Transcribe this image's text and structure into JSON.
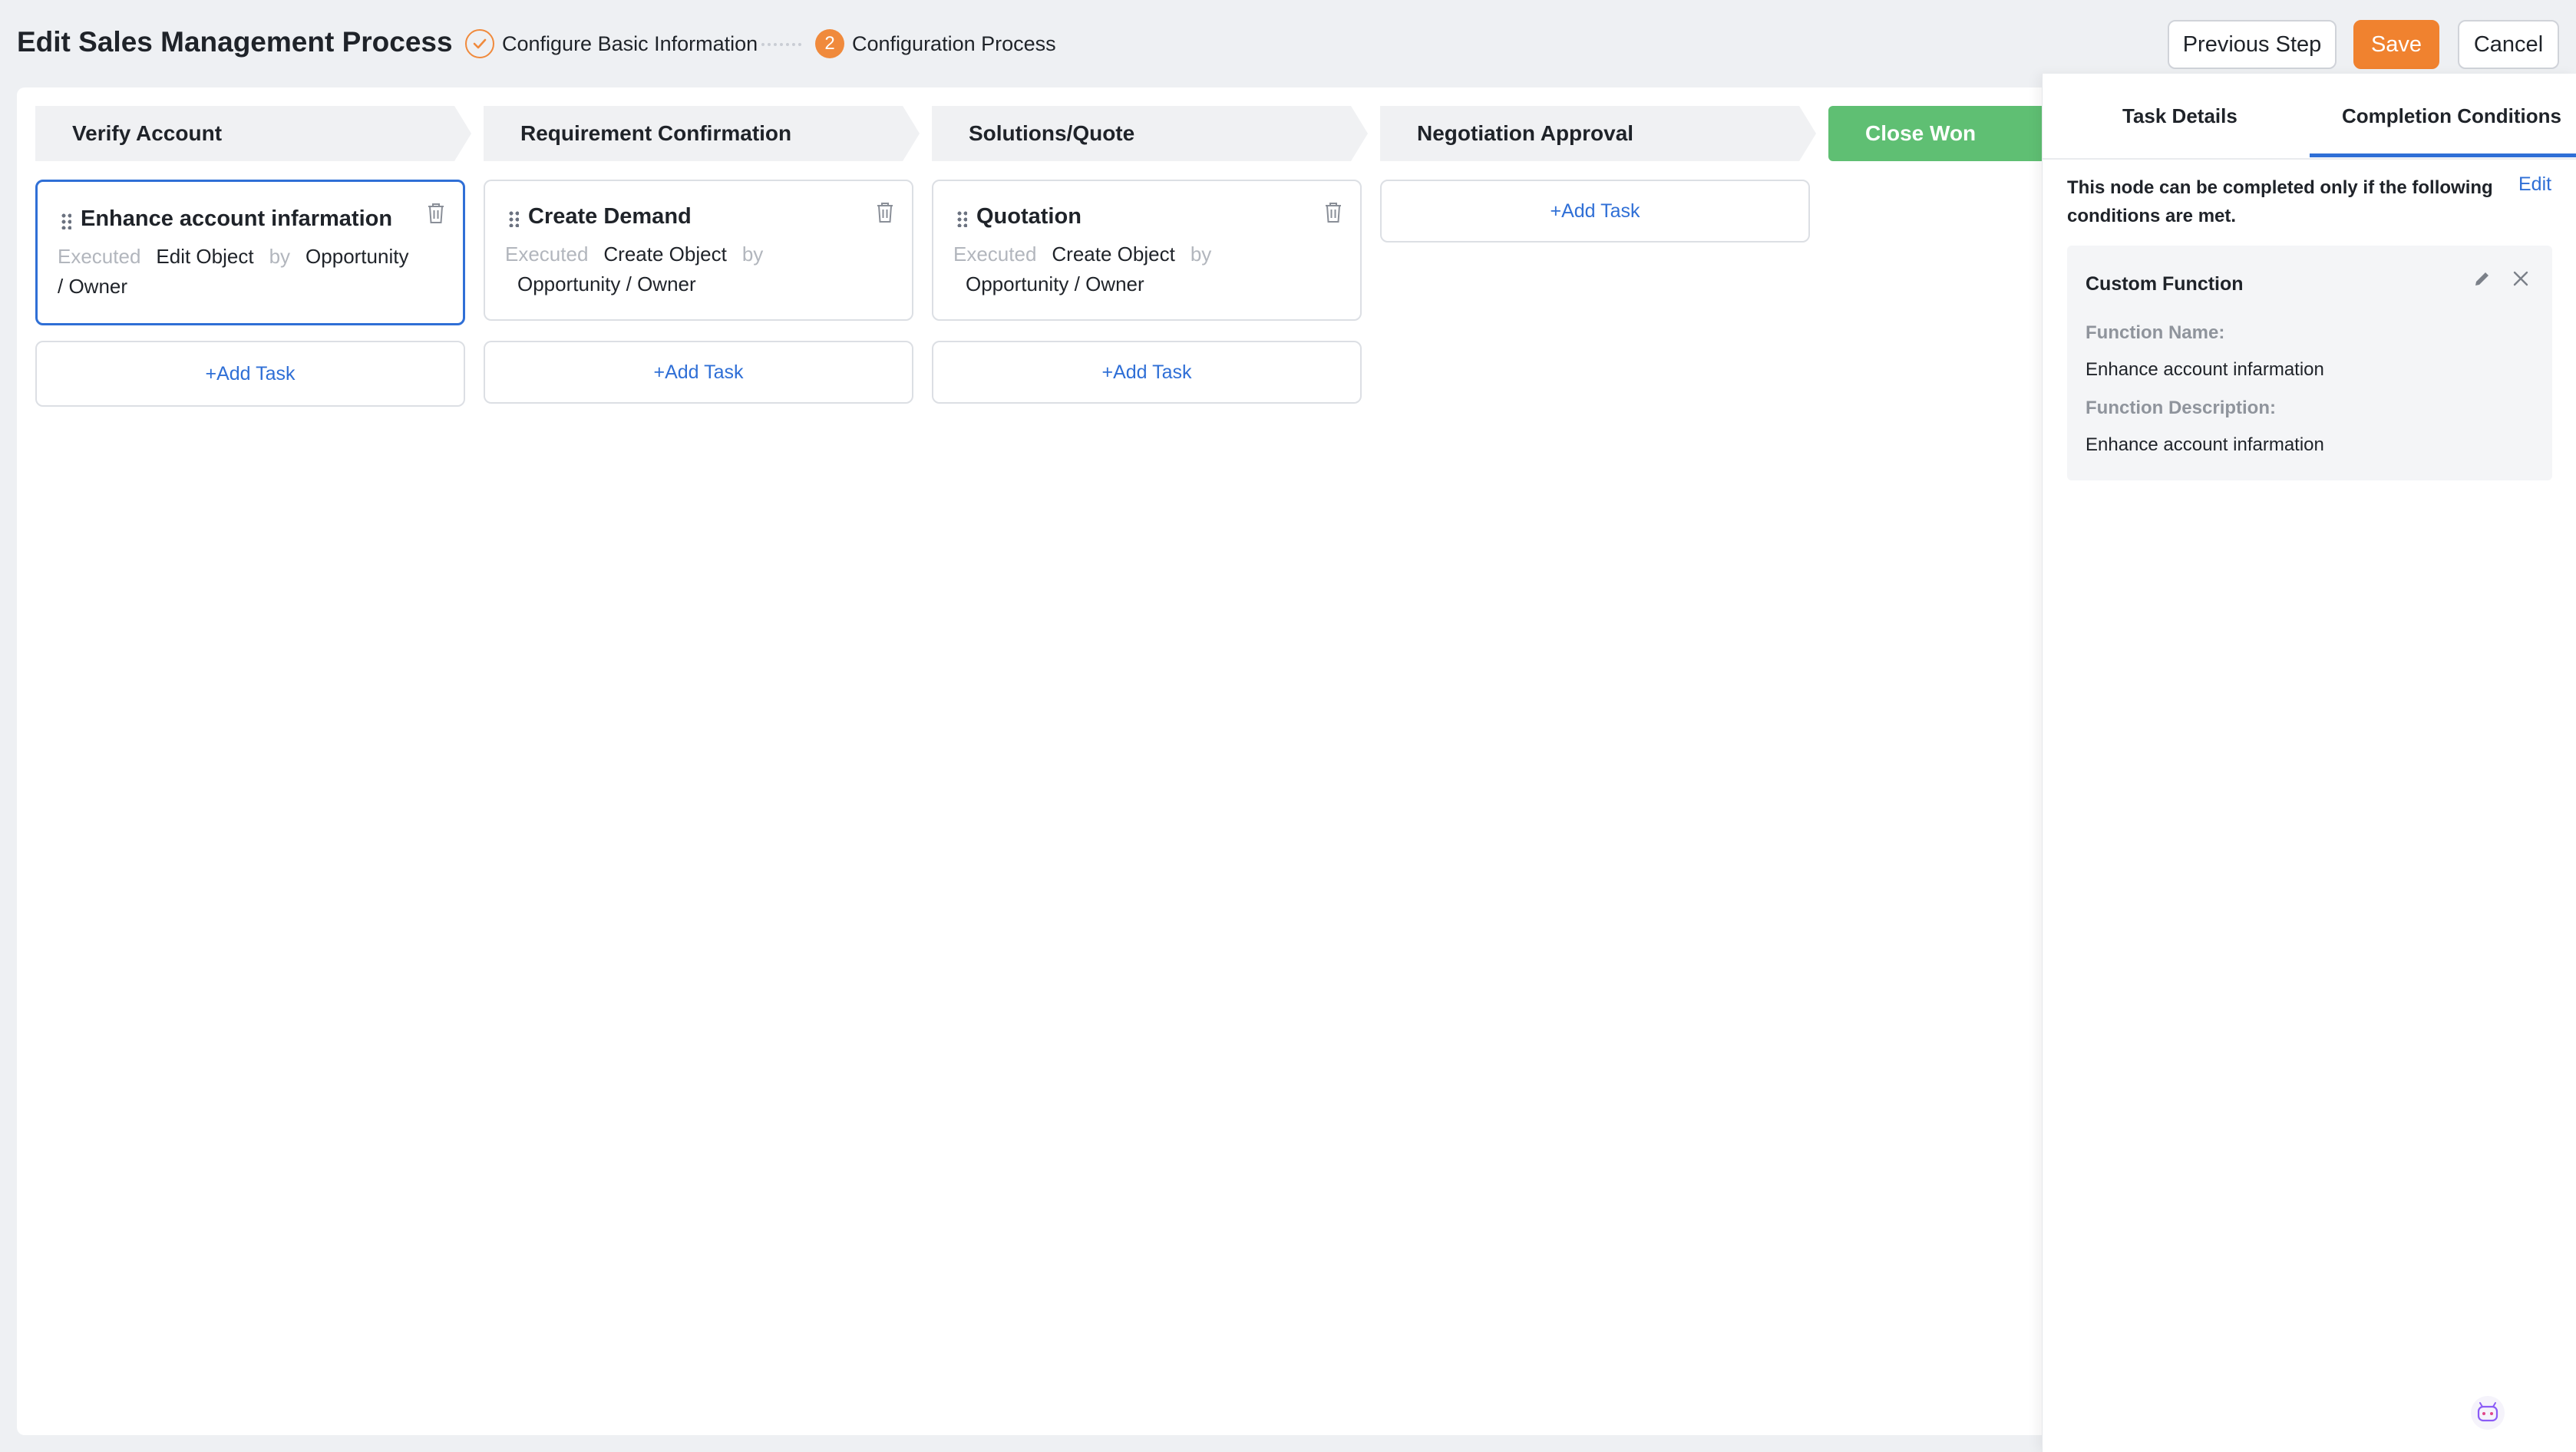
{
  "header": {
    "title": "Edit Sales Management Process",
    "steps": [
      {
        "label": "Configure Basic Information",
        "status": "done"
      },
      {
        "number": "2",
        "label": "Configuration Process",
        "status": "active"
      }
    ],
    "buttons": {
      "previous": "Previous Step",
      "save": "Save",
      "cancel": "Cancel"
    }
  },
  "stages": [
    {
      "name": "Verify Account"
    },
    {
      "name": "Requirement Confirmation"
    },
    {
      "name": "Solutions/Quote"
    },
    {
      "name": "Negotiation Approval"
    },
    {
      "name": "Close Won"
    }
  ],
  "tasks": [
    {
      "title": "Enhance account infarmation",
      "executed": "Executed",
      "action": "Edit Object",
      "by": "by",
      "object": "Opportunity",
      "role": "/ Owner"
    },
    {
      "title": "Create Demand",
      "executed": "Executed",
      "action": "Create Object",
      "by": "by",
      "object": "Opportunity / Owner"
    },
    {
      "title": "Quotation",
      "executed": "Executed",
      "action": "Create Object",
      "by": "by",
      "object": "Opportunity / Owner"
    }
  ],
  "add_task_label": "+Add Task",
  "panel": {
    "tabs": [
      "Task Details",
      "Completion Conditions"
    ],
    "active_tab": "Completion Conditions",
    "condition_text": "This node can be completed only if the following conditions are met.",
    "edit_label": "Edit",
    "function": {
      "title": "Custom Function",
      "name_label": "Function Name:",
      "name_value": "Enhance account infarmation",
      "desc_label": "Function Description:",
      "desc_value": "Enhance account infarmation"
    }
  },
  "colors": {
    "accent": "#2f6fd6",
    "brand_orange": "#f0822f",
    "won_green": "#5fbf73"
  }
}
